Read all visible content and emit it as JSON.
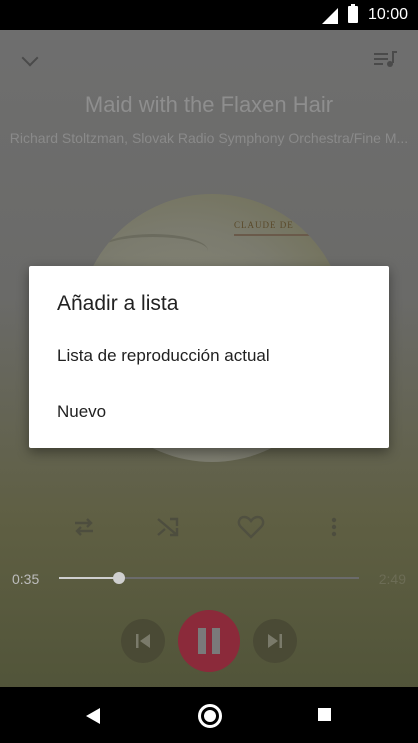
{
  "status_bar": {
    "time": "10:00"
  },
  "player": {
    "title": "Maid with the Flaxen Hair",
    "artist": "Richard Stoltzman, Slovak Radio Symphony Orchestra/Fine M...",
    "album_text": "CLAUDE DE",
    "elapsed": "0:35",
    "total": "2:49",
    "progress": 0.2
  },
  "dialog": {
    "title": "Añadir a lista",
    "options": [
      {
        "label": "Lista de reproducción actual"
      },
      {
        "label": "Nuevo"
      }
    ]
  },
  "colors": {
    "pause_button": "#8b2a3a",
    "dialog_bg": "#ffffff",
    "scrim_text": "#8e8e8e"
  },
  "icons": {
    "collapse": "chevron-down-icon",
    "queue": "queue-music-icon",
    "repeat": "repeat-icon",
    "shuffle": "shuffle-icon",
    "favorite": "heart-icon",
    "more": "more-vert-icon",
    "previous": "skip-previous-icon",
    "pause": "pause-icon",
    "next": "skip-next-icon"
  }
}
